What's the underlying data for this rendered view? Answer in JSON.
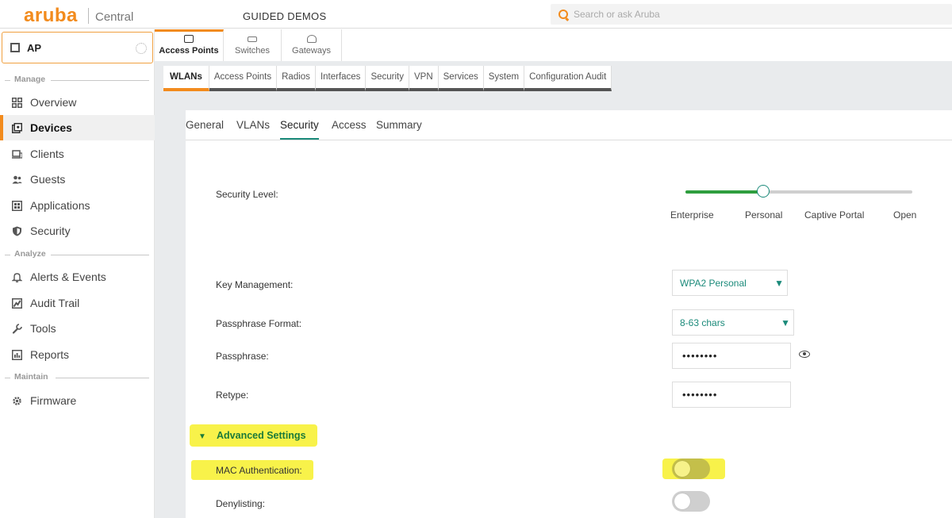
{
  "header": {
    "logo": "aruba",
    "product": "Central",
    "section_title": "GUIDED DEMOS",
    "search_placeholder": "Search or ask Aruba"
  },
  "sidebar": {
    "context_label": "AP",
    "sections": {
      "manage": "Manage",
      "analyze": "Analyze",
      "maintain": "Maintain"
    },
    "items": [
      {
        "label": "Overview",
        "icon": "grid-icon",
        "active": false
      },
      {
        "label": "Devices",
        "icon": "devices-icon",
        "active": true
      },
      {
        "label": "Clients",
        "icon": "laptop-icon",
        "active": false
      },
      {
        "label": "Guests",
        "icon": "users-icon",
        "active": false
      },
      {
        "label": "Applications",
        "icon": "apps-icon",
        "active": false
      },
      {
        "label": "Security",
        "icon": "shield-icon",
        "active": false
      },
      {
        "label": "Alerts & Events",
        "icon": "bell-icon",
        "active": false
      },
      {
        "label": "Audit Trail",
        "icon": "audit-icon",
        "active": false
      },
      {
        "label": "Tools",
        "icon": "wrench-icon",
        "active": false
      },
      {
        "label": "Reports",
        "icon": "report-icon",
        "active": false
      },
      {
        "label": "Firmware",
        "icon": "gear-icon",
        "active": false
      }
    ]
  },
  "device_tabs": [
    {
      "label": "Access Points",
      "active": true
    },
    {
      "label": "Switches",
      "active": false
    },
    {
      "label": "Gateways",
      "active": false
    }
  ],
  "sub_tabs": [
    {
      "label": "WLANs",
      "active": true
    },
    {
      "label": "Access Points"
    },
    {
      "label": "Radios"
    },
    {
      "label": "Interfaces"
    },
    {
      "label": "Security"
    },
    {
      "label": "VPN"
    },
    {
      "label": "Services"
    },
    {
      "label": "System"
    },
    {
      "label": "Configuration Audit"
    }
  ],
  "wizard_tabs": [
    {
      "label": "General"
    },
    {
      "label": "VLANs"
    },
    {
      "label": "Security",
      "active": true
    },
    {
      "label": "Access"
    },
    {
      "label": "Summary"
    }
  ],
  "form": {
    "security_level_label": "Security Level:",
    "security_levels": [
      "Enterprise",
      "Personal",
      "Captive Portal",
      "Open"
    ],
    "security_level_selected": "Personal",
    "key_management_label": "Key Management:",
    "key_management_value": "WPA2 Personal",
    "passphrase_format_label": "Passphrase Format:",
    "passphrase_format_value": "8-63 chars",
    "passphrase_label": "Passphrase:",
    "passphrase_value": "••••••••",
    "retype_label": "Retype:",
    "retype_value": "••••••••",
    "advanced_settings_label": "Advanced Settings",
    "mac_auth_label": "MAC Authentication:",
    "mac_auth_enabled": false,
    "denylisting_label": "Denylisting:",
    "denylisting_enabled": false
  },
  "colors": {
    "brand_orange": "#f28b1d",
    "teal_accent": "#1b8a7a",
    "slider_green": "#2e9e3e",
    "highlight_yellow": "#f8f24a"
  }
}
